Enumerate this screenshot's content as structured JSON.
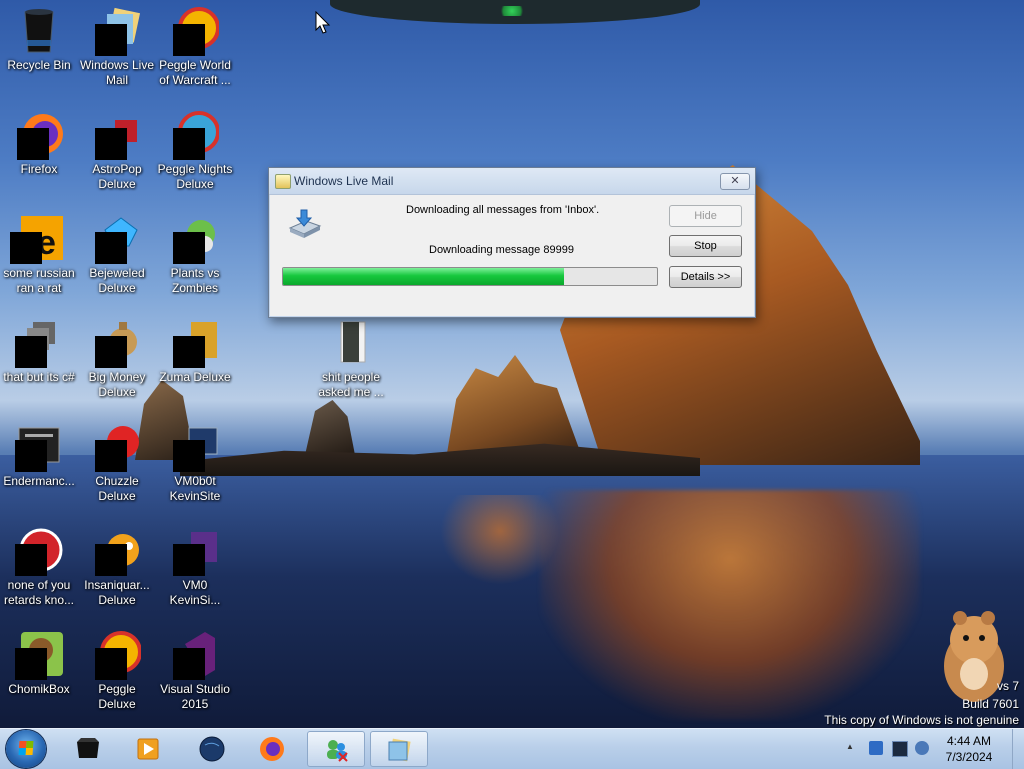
{
  "desktop": {
    "icons": [
      {
        "label": "Recycle Bin"
      },
      {
        "label": "Windows Live Mail"
      },
      {
        "label": "Peggle World of Warcraft ..."
      },
      {
        "label": "Firefox"
      },
      {
        "label": "AstroPop Deluxe"
      },
      {
        "label": "Peggle Nights Deluxe"
      },
      {
        "label": "some russian ran a rat"
      },
      {
        "label": "Bejeweled Deluxe"
      },
      {
        "label": "Plants vs Zombies"
      },
      {
        "label": "that but its c#"
      },
      {
        "label": "Big Money Deluxe"
      },
      {
        "label": "Zuma Deluxe"
      },
      {
        "label": "shit people asked me ..."
      },
      {
        "label": "Endermanc..."
      },
      {
        "label": "Chuzzle Deluxe"
      },
      {
        "label": "VM0b0t KevinSite"
      },
      {
        "label": "none of you retards kno..."
      },
      {
        "label": "Insaniquar... Deluxe"
      },
      {
        "label": "VM0 KevinSi..."
      },
      {
        "label": "ChomikBox"
      },
      {
        "label": "Peggle Deluxe"
      },
      {
        "label": "Visual Studio 2015"
      }
    ],
    "watermark": {
      "line1": "vs 7",
      "line2": "Build 7601",
      "line3": "This copy of Windows is not genuine"
    }
  },
  "dialog": {
    "title": "Windows Live Mail",
    "close_symbol": "✕",
    "status_folder": "Downloading all messages from 'Inbox'.",
    "status_message": "Downloading message 89999",
    "progress_percent": 75,
    "buttons": {
      "hide": "Hide",
      "stop": "Stop",
      "details": "Details >>"
    }
  },
  "taskbar": {
    "items": [
      "windows-media-center",
      "windows-media-player",
      "system-globe",
      "firefox",
      "windows-live-messenger",
      "windows-live-mail"
    ],
    "clock": {
      "time": "4:44 AM",
      "date": "7/3/2024"
    },
    "tray_arrow": "▲"
  }
}
